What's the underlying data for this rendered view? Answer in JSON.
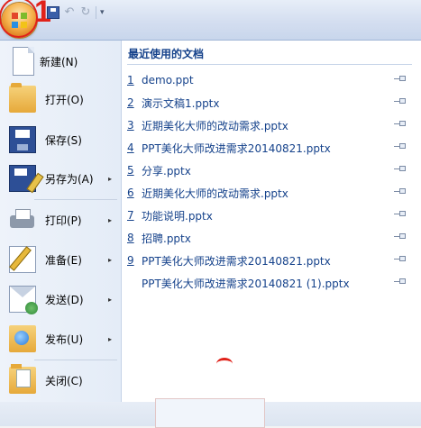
{
  "annotation": {
    "step_number": "1"
  },
  "quick_access": {
    "dropdown_glyph": "▾",
    "undo_glyph": "↶",
    "redo_glyph": "↻"
  },
  "menu": {
    "items": [
      {
        "label": "新建(N)",
        "icon": "new-document-icon",
        "has_submenu": false
      },
      {
        "label": "打开(O)",
        "icon": "open-folder-icon",
        "has_submenu": false
      },
      {
        "label": "保存(S)",
        "icon": "save-disk-icon",
        "has_submenu": false
      },
      {
        "label": "另存为(A)",
        "icon": "save-as-icon",
        "has_submenu": true
      },
      {
        "label": "打印(P)",
        "icon": "printer-icon",
        "has_submenu": true
      },
      {
        "label": "准备(E)",
        "icon": "prepare-pencil-icon",
        "has_submenu": true
      },
      {
        "label": "发送(D)",
        "icon": "send-mail-icon",
        "has_submenu": true
      },
      {
        "label": "发布(U)",
        "icon": "publish-icon",
        "has_submenu": true
      },
      {
        "label": "关闭(C)",
        "icon": "close-folder-icon",
        "has_submenu": false
      }
    ],
    "submenu_arrow": "▸"
  },
  "recent": {
    "title": "最近使用的文档",
    "documents": [
      {
        "num": "1",
        "name": "demo.ppt"
      },
      {
        "num": "2",
        "name": "演示文稿1.pptx"
      },
      {
        "num": "3",
        "name": "近期美化大师的改动需求.pptx"
      },
      {
        "num": "4",
        "name": "PPT美化大师改进需求20140821.pptx"
      },
      {
        "num": "5",
        "name": "分享.pptx"
      },
      {
        "num": "6",
        "name": "近期美化大师的改动需求.pptx"
      },
      {
        "num": "7",
        "name": "功能说明.pptx"
      },
      {
        "num": "8",
        "name": "招聘.pptx"
      },
      {
        "num": "9",
        "name": "PPT美化大师改进需求20140821.pptx"
      },
      {
        "num": "",
        "name": "PPT美化大师改进需求20140821 (1).pptx"
      }
    ]
  }
}
